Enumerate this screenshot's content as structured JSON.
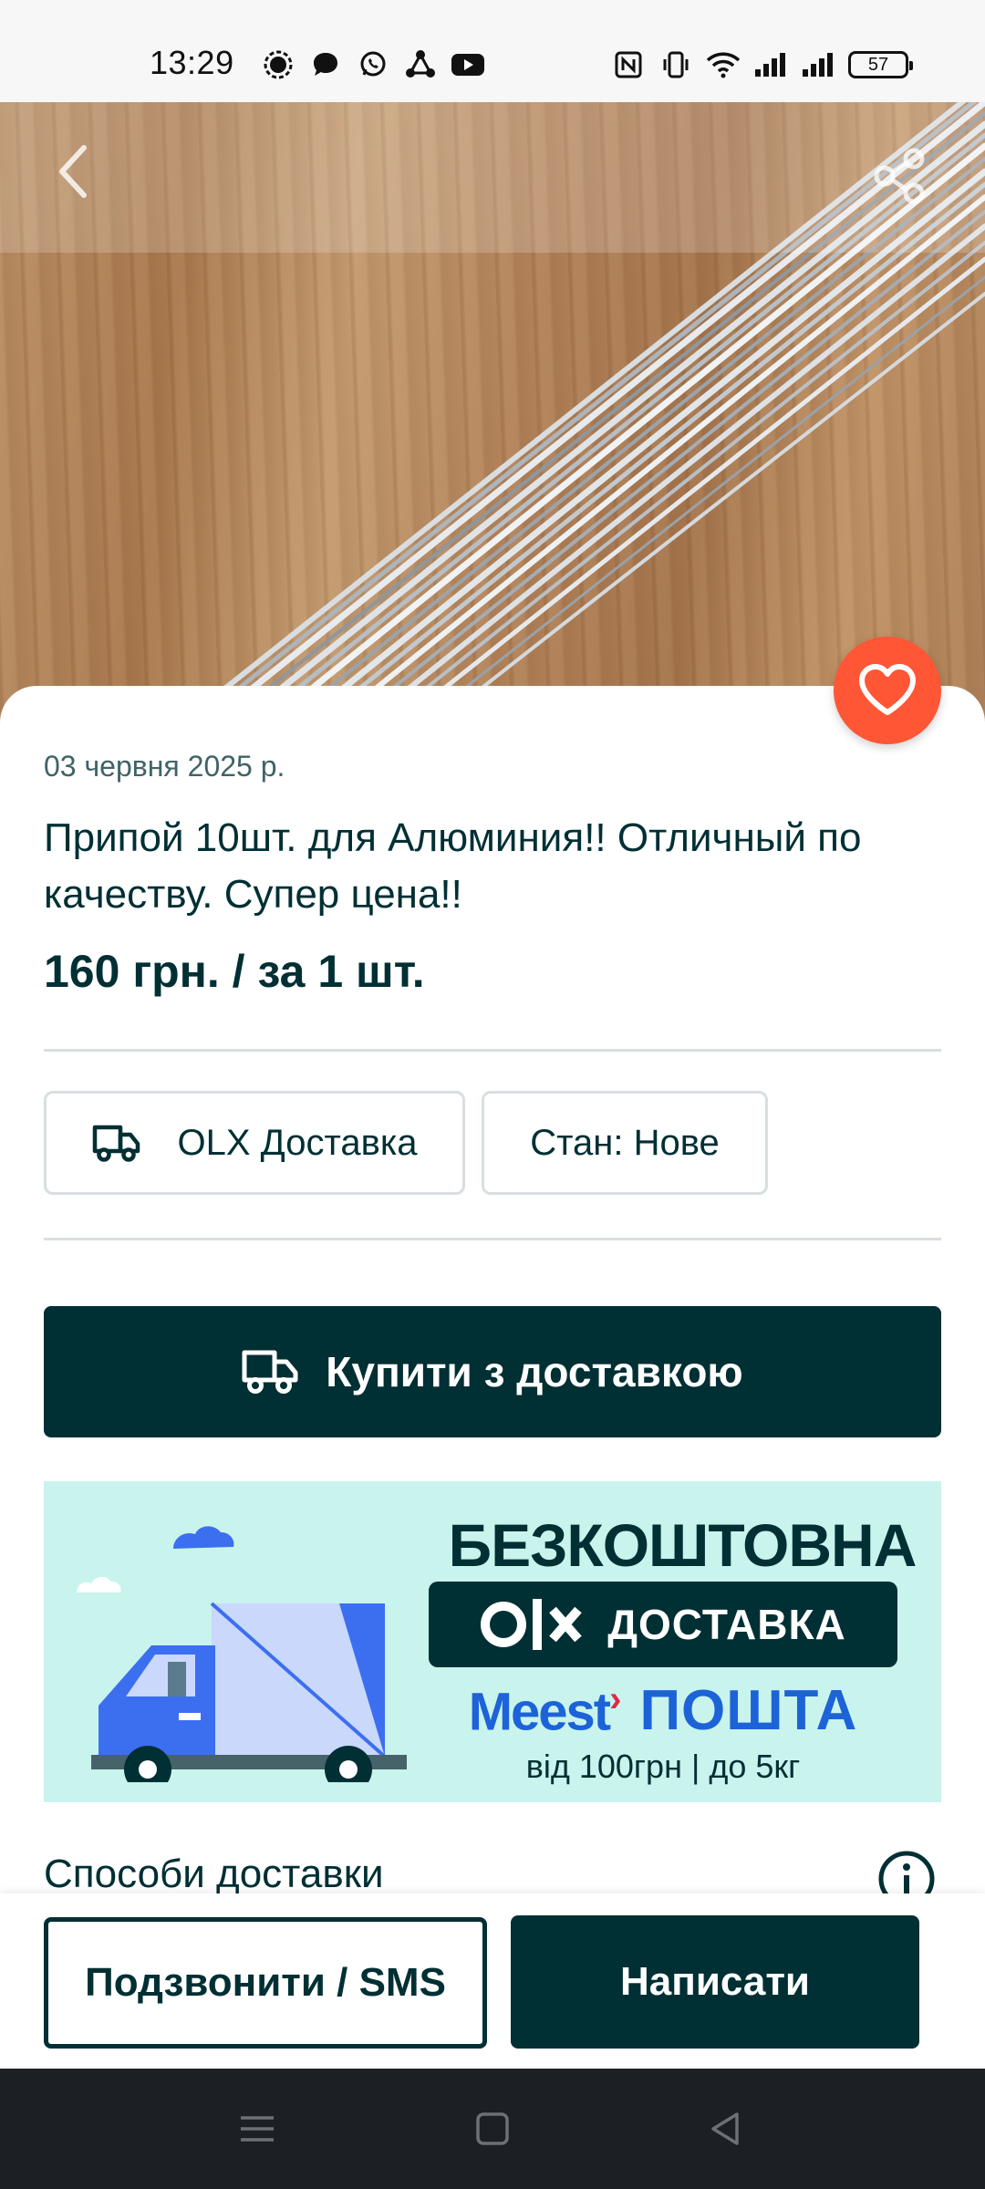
{
  "status_bar": {
    "time": "13:29",
    "battery": "57",
    "left_icons": [
      "signal-app-icon",
      "chat-bubble-icon",
      "whatsapp-icon",
      "share-network-icon",
      "youtube-icon"
    ],
    "right_icons": [
      "nfc-icon",
      "vibrate-icon",
      "wifi-icon",
      "cell-signal-icon",
      "cell-signal-icon",
      "battery-icon"
    ]
  },
  "listing": {
    "date": "03 червня 2025 р.",
    "title": "Припой 10шт. для Алюминия!! Отличный по качеству. Супер цена!!",
    "price": "160 грн. / за 1 шт.",
    "chips": {
      "delivery": "OLX Доставка",
      "condition": "Стан: Нове"
    },
    "buy_button": "Купити з доставкою"
  },
  "banner": {
    "headline": "БЕЗКОШТОВНА",
    "olx_delivery": "ДОСТАВКА",
    "meest": "Meest",
    "poshta": "ПОШТА",
    "note": "від 100грн | до 5кг"
  },
  "sections": {
    "delivery_methods": "Способи доставки"
  },
  "actions": {
    "call": "Подзвонити / SMS",
    "write": "Написати"
  },
  "colors": {
    "brand_dark": "#002f34",
    "favorite": "#ff5636",
    "banner_bg": "#c8f4ed",
    "meest_blue": "#1d63d8"
  }
}
